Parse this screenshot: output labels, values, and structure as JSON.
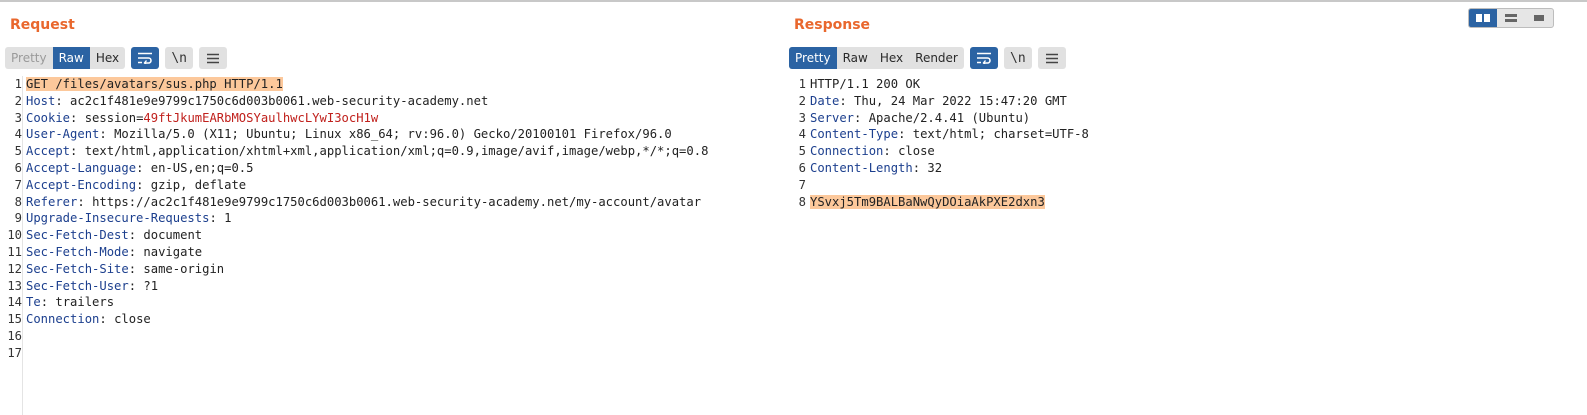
{
  "request": {
    "title": "Request",
    "view_tabs": [
      {
        "label": "Pretty",
        "state": "disabled"
      },
      {
        "label": "Raw",
        "state": "active"
      },
      {
        "label": "Hex",
        "state": "normal"
      }
    ],
    "newline_label": "\\n",
    "line_numbers": [
      "1",
      "2",
      "3",
      "4",
      "5",
      "6",
      "7",
      "8",
      "9",
      "10",
      "11",
      "12",
      "13",
      "14",
      "15",
      "16",
      "17"
    ],
    "lines": [
      {
        "key": "",
        "sep": "",
        "value": "GET /files/avatars/sus.php HTTP/1.1"
      },
      {
        "key": "Host",
        "sep": ": ",
        "value": "ac2c1f481e9e9799c1750c6d003b0061.web-security-academy.net"
      },
      {
        "key": "Cookie",
        "sep": ": ",
        "value": "session=49ftJkumEARbMOSYaulhwcLYwI3ocH1w"
      },
      {
        "key": "User-Agent",
        "sep": ": ",
        "value": "Mozilla/5.0 (X11; Ubuntu; Linux x86_64; rv:96.0) Gecko/20100101 Firefox/96.0"
      },
      {
        "key": "Accept",
        "sep": ": ",
        "value": "text/html,application/xhtml+xml,application/xml;q=0.9,image/avif,image/webp,*/*;q=0.8"
      },
      {
        "key": "Accept-Language",
        "sep": ": ",
        "value": "en-US,en;q=0.5"
      },
      {
        "key": "Accept-Encoding",
        "sep": ": ",
        "value": "gzip, deflate"
      },
      {
        "key": "Referer",
        "sep": ": ",
        "value": "https://ac2c1f481e9e9799c1750c6d003b0061.web-security-academy.net/my-account/avatar"
      },
      {
        "key": "Upgrade-Insecure-Requests",
        "sep": ": ",
        "value": "1"
      },
      {
        "key": "Sec-Fetch-Dest",
        "sep": ": ",
        "value": "document"
      },
      {
        "key": "Sec-Fetch-Mode",
        "sep": ": ",
        "value": "navigate"
      },
      {
        "key": "Sec-Fetch-Site",
        "sep": ": ",
        "value": "same-origin"
      },
      {
        "key": "Sec-Fetch-User",
        "sep": ": ",
        "value": "?1"
      },
      {
        "key": "Te",
        "sep": ": ",
        "value": "trailers"
      },
      {
        "key": "Connection",
        "sep": ": ",
        "value": "close"
      },
      {
        "key": "",
        "sep": "",
        "value": ""
      },
      {
        "key": "",
        "sep": "",
        "value": ""
      }
    ]
  },
  "response": {
    "title": "Response",
    "view_tabs": [
      {
        "label": "Pretty",
        "state": "active"
      },
      {
        "label": "Raw",
        "state": "normal"
      },
      {
        "label": "Hex",
        "state": "normal"
      },
      {
        "label": "Render",
        "state": "normal"
      }
    ],
    "newline_label": "\\n",
    "line_numbers": [
      "1",
      "2",
      "3",
      "4",
      "5",
      "6",
      "7",
      "8"
    ],
    "lines": [
      {
        "key": "",
        "sep": "",
        "value": "HTTP/1.1 200 OK"
      },
      {
        "key": "Date",
        "sep": ": ",
        "value": "Thu, 24 Mar 2022 15:47:20 GMT"
      },
      {
        "key": "Server",
        "sep": ": ",
        "value": "Apache/2.4.41 (Ubuntu)"
      },
      {
        "key": "Content-Type",
        "sep": ": ",
        "value": "text/html; charset=UTF-8"
      },
      {
        "key": "Connection",
        "sep": ": ",
        "value": "close"
      },
      {
        "key": "Content-Length",
        "sep": ": ",
        "value": "32"
      },
      {
        "key": "",
        "sep": "",
        "value": ""
      },
      {
        "key": "",
        "sep": "",
        "value": "YSvxj5Tm9BALBaNwQyDOiaAkPXE2dxn3"
      }
    ]
  },
  "colors": {
    "accent": "#e9672d",
    "active_blue": "#2b63a3",
    "highlight": "#fcc89b",
    "header_key": "#1c3f8e",
    "cookie_value": "#c0201c"
  },
  "icons": {
    "wrap": "wrap-lines-icon",
    "menu": "hamburger-menu-icon",
    "layout": [
      "layout-columns-icon",
      "layout-rows-icon",
      "layout-single-icon"
    ]
  }
}
